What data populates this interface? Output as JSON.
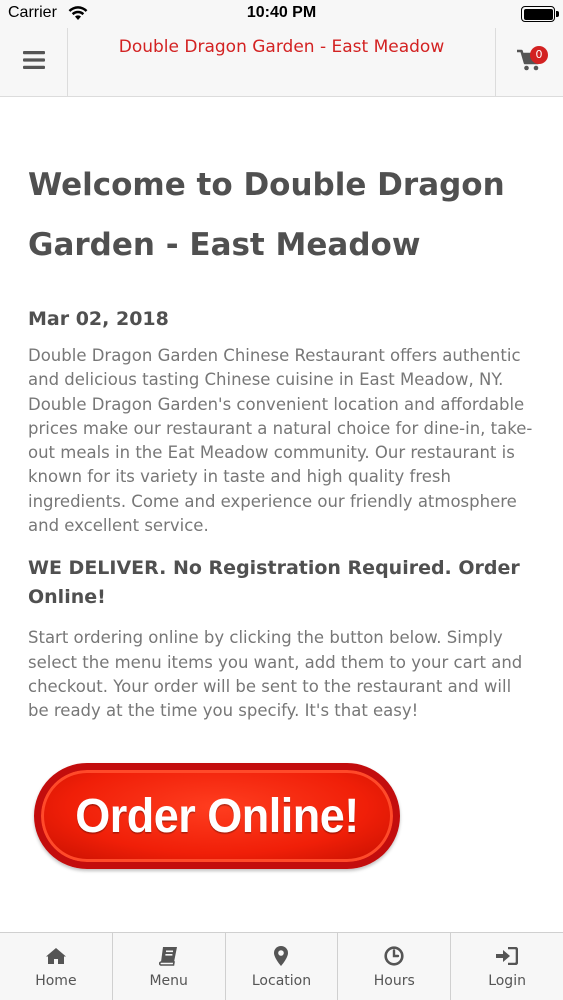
{
  "status_bar": {
    "carrier": "Carrier",
    "time": "10:40 PM"
  },
  "header": {
    "title": "Double Dragon Garden - East Meadow",
    "cart_count": "0",
    "menu_icon": "hamburger-icon",
    "cart_icon": "cart-icon"
  },
  "main": {
    "title": "Welcome to Double Dragon Garden - East Meadow",
    "date": "Mar 02, 2018",
    "description": "Double Dragon Garden Chinese Restaurant offers authentic and delicious tasting Chinese cuisine in East Meadow, NY.  Double Dragon Garden's convenient location and affordable prices make our restaurant a natural choice for dine-in, take-out meals in the Eat Meadow community. Our restaurant is known for its variety in taste and high quality fresh ingredients. Come and experience our friendly atmosphere and excellent service.",
    "deliver_heading": "WE DELIVER. No Registration Required. Order Online!",
    "order_instructions": "Start ordering online by clicking the button below. Simply select the menu items you want, add them to your cart and checkout. Your order will be sent to the restaurant and will be ready at the time you specify. It's that easy!",
    "order_button": "Order Online!"
  },
  "tabs": [
    {
      "label": "Home",
      "icon": "home-icon"
    },
    {
      "label": "Menu",
      "icon": "book-icon"
    },
    {
      "label": "Location",
      "icon": "map-marker-icon"
    },
    {
      "label": "Hours",
      "icon": "clock-icon"
    },
    {
      "label": "Login",
      "icon": "sign-in-icon"
    }
  ],
  "colors": {
    "brand_red": "#d32222",
    "button_red": "#f01f08"
  }
}
